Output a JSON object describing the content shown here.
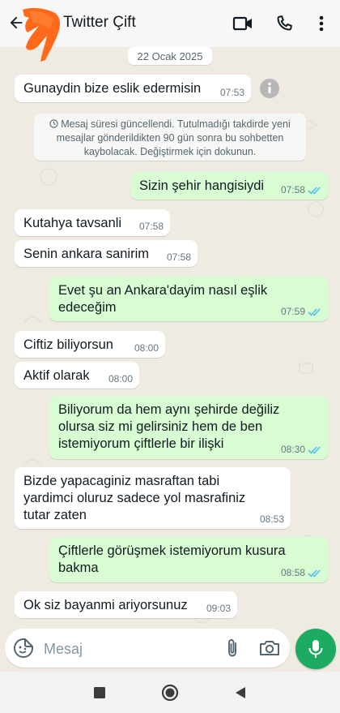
{
  "header": {
    "title": "Twitter Çift",
    "back_icon": "arrow-left-icon",
    "video_icon": "video-camera-icon",
    "call_icon": "phone-icon",
    "menu_icon": "more-vertical-icon"
  },
  "chat": {
    "date": "22 Ocak 2025",
    "system_note": "Mesaj süresi güncellendi. Tutulmadığı takdirde yeni mesajlar gönderildikten 90 gün sonra bu sohbetten kaybolacak. Değiştirmek için dokunun.",
    "messages": [
      {
        "direction": "in",
        "text": "Gunaydin bize eslik edermisin",
        "time": "07:53"
      },
      {
        "direction": "out",
        "text": "Sizin şehir hangisiydi",
        "time": "07:58",
        "status": "read"
      },
      {
        "direction": "in",
        "text": "Kutahya tavsanli",
        "time": "07:58"
      },
      {
        "direction": "in",
        "text": "Senin ankara sanirim",
        "time": "07:58"
      },
      {
        "direction": "out",
        "text": "Evet şu an Ankara'dayim nasıl eşlik\nedeceğim",
        "time": "07:59",
        "status": "read"
      },
      {
        "direction": "in",
        "text": "Ciftiz biliyorsun",
        "time": "08:00"
      },
      {
        "direction": "in",
        "text": "Aktif olarak",
        "time": "08:00"
      },
      {
        "direction": "out",
        "text": "Biliyorum da hem aynı şehirde değiliz\nolursa siz mi gelirsiniz hem de ben\nistemiyorum çiftlerle bir ilişki",
        "time": "08:30",
        "status": "read"
      },
      {
        "direction": "in",
        "text": "Bizde yapacaginiz masraftan tabi\nyardimci oluruz sadece yol masrafiniz\ntutar zaten",
        "time": "08:53"
      },
      {
        "direction": "out",
        "text": "Çiftlerle görüşmek istemiyorum kusura\nbakma",
        "time": "08:58",
        "status": "read"
      },
      {
        "direction": "in",
        "text": "Ok siz bayanmi ariyorsunuz",
        "time": "09:03"
      }
    ]
  },
  "composer": {
    "placeholder": "Mesaj",
    "value": ""
  },
  "colors": {
    "incoming_bubble": "#ffffff",
    "outgoing_bubble": "#d9fdd3",
    "read_ticks": "#53bdeb",
    "mic_button": "#1daa61",
    "avatar_scribble": "#ff6a1a"
  }
}
